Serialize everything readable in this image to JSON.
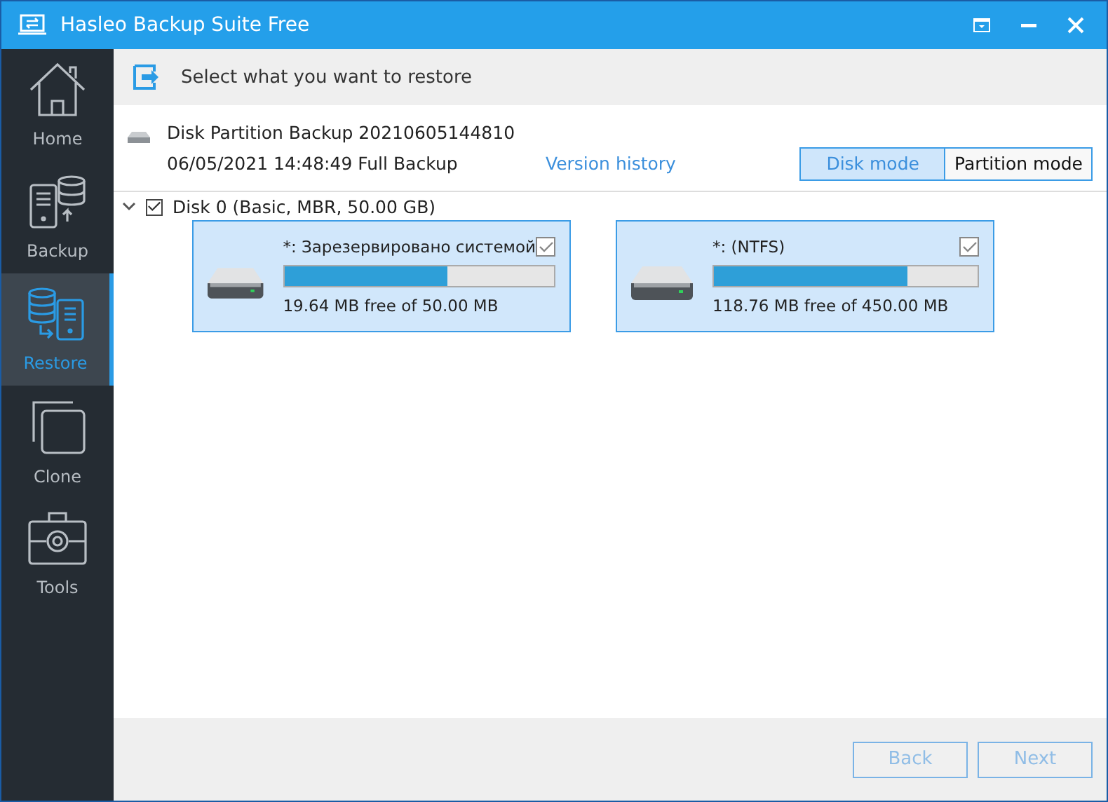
{
  "window": {
    "title": "Hasleo Backup Suite Free"
  },
  "sidebar": {
    "items": [
      {
        "label": "Home",
        "kind": "home",
        "selected": false
      },
      {
        "label": "Backup",
        "kind": "backup",
        "selected": false
      },
      {
        "label": "Restore",
        "kind": "restore",
        "selected": true
      },
      {
        "label": "Clone",
        "kind": "clone",
        "selected": false
      },
      {
        "label": "Tools",
        "kind": "tools",
        "selected": false
      }
    ]
  },
  "header": {
    "title": "Select what you want to restore"
  },
  "backup": {
    "name": "Disk Partition Backup 20210605144810",
    "details": "06/05/2021 14:48:49 Full Backup",
    "version_link": "Version history"
  },
  "modes": [
    {
      "label": "Disk mode",
      "selected": true
    },
    {
      "label": "Partition mode",
      "selected": false
    }
  ],
  "disk": {
    "label": "Disk 0 (Basic, MBR, 50.00 GB)",
    "expanded": true,
    "checked": true,
    "partitions": [
      {
        "name": "*: Зарезервировано системой",
        "checked": true,
        "selected": true,
        "level": 0.607,
        "usage": "19.64 MB free of 50.00 MB"
      },
      {
        "name": "*: (NTFS)",
        "checked": true,
        "selected": true,
        "level": 0.736,
        "usage": "118.76 MB free of 450.00 MB"
      }
    ]
  },
  "buttons": [
    {
      "label": "Back",
      "disabled": true
    },
    {
      "label": "Next",
      "disabled": true
    }
  ]
}
